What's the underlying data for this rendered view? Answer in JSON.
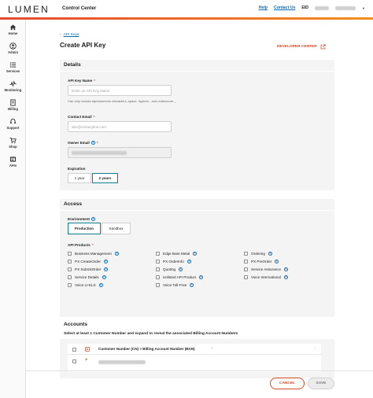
{
  "header": {
    "logo": "LUMEN",
    "app_title": "Control Center",
    "help": "Help",
    "contact": "Contact Us",
    "eid_label": "EID"
  },
  "sidebar": {
    "items": [
      {
        "label": "Home",
        "icon": "home-icon"
      },
      {
        "label": "Admin",
        "icon": "user-icon"
      },
      {
        "label": "Services",
        "icon": "list-icon"
      },
      {
        "label": "Monitoring",
        "icon": "pulse-icon"
      },
      {
        "label": "Billing",
        "icon": "invoice-icon"
      },
      {
        "label": "Support",
        "icon": "support-icon"
      },
      {
        "label": "Shop",
        "icon": "cart-icon"
      },
      {
        "label": "APIs",
        "icon": "api-icon"
      }
    ]
  },
  "page": {
    "breadcrumb": "API Keys",
    "title": "Create API Key",
    "developer_center": "DEVELOPER CENTER"
  },
  "details": {
    "title": "Details",
    "api_key_name": {
      "label": "API Key Name",
      "placeholder": "Enter an API Key Name",
      "helper": "Can only contain alphanumeric characters, space, hyphen - and underscore _"
    },
    "contact_email": {
      "label": "Contact Email",
      "placeholder": "abc@centurylink.com"
    },
    "owner_email": {
      "label": "Owner Email"
    },
    "expiration": {
      "label": "Expiration",
      "options": [
        "1 year",
        "2 years"
      ],
      "selected": "2 years"
    }
  },
  "access": {
    "title": "Access",
    "environment": {
      "label": "Environment",
      "options": [
        "Production",
        "Sandbox"
      ],
      "selected": "Production"
    },
    "api_products": {
      "label": "API Products",
      "columns": [
        [
          "Business Management",
          "PX CreateOrder",
          "PX SubmitOrder",
          "Service Details",
          "Voice LI-ELS"
        ],
        [
          "Edge Bare Metal",
          "PX OrderInfo",
          "Quoting",
          "Unlisted API Product",
          "Voice Toll-Free"
        ],
        [
          "Ordering",
          "PX PreOrder",
          "Service Assurance",
          "Voice International"
        ]
      ]
    }
  },
  "accounts": {
    "title": "Accounts",
    "instruction": "Select at least 1 Customer Number and expand to reveal the associated Billing Account Numbers",
    "column_header": "Customer Number (CN) > Billing Account Number (BAN)"
  },
  "footer": {
    "cancel": "CANCEL",
    "save": "SAVE"
  },
  "colors": {
    "accent": "#d14b27",
    "link": "#0a6bb7",
    "selected_border": "#0f7d8a"
  }
}
